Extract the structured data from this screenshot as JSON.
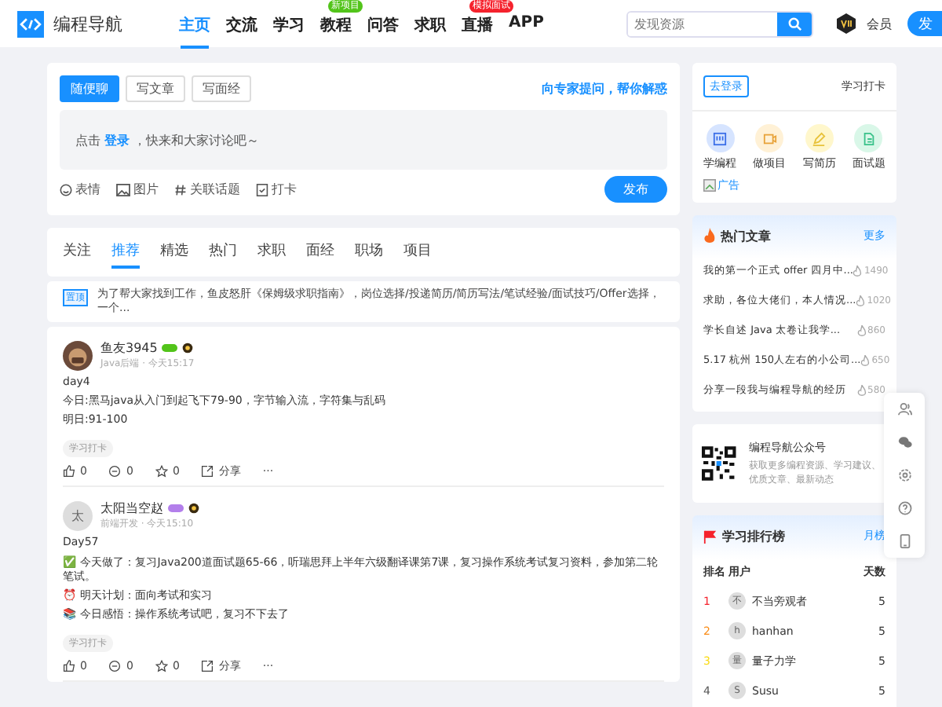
{
  "header": {
    "logo": "编程导航",
    "nav": [
      {
        "label": "主页",
        "selected": true
      },
      {
        "label": "交流",
        "selected": false
      },
      {
        "label": "学习",
        "selected": false
      },
      {
        "label": "教程",
        "selected": false,
        "badge": "新项目",
        "color": "#52c41a"
      },
      {
        "label": "问答",
        "selected": false
      },
      {
        "label": "求职",
        "selected": false
      },
      {
        "label": "直播",
        "selected": false,
        "badge": "模拟面试",
        "color": "#f5222d"
      },
      {
        "label": "APP",
        "selected": false
      }
    ],
    "search": {
      "placeholder": "发现资源"
    },
    "vip": "会员",
    "publish": "发"
  },
  "composer": {
    "tabs": [
      {
        "label": "随便聊",
        "selected": true
      },
      {
        "label": "写文章",
        "selected": false
      },
      {
        "label": "写面经",
        "selected": false
      }
    ],
    "ask_link": "向专家提问，帮你解惑",
    "prompt": "点击 **登录** ，快来和大家讨论吧～",
    "tools": [
      {
        "kind": "emoji",
        "label": "表情"
      },
      {
        "kind": "image",
        "label": "图片"
      },
      {
        "kind": "topic",
        "label": "关联话题"
      },
      {
        "kind": "checkin",
        "label": "打卡"
      }
    ],
    "submit": "发布"
  },
  "feed_tabs": [
    {
      "label": "关注",
      "selected": false
    },
    {
      "label": "推荐",
      "selected": true
    },
    {
      "label": "精选",
      "selected": false
    },
    {
      "label": "热门",
      "selected": false
    },
    {
      "label": "求职",
      "selected": false
    },
    {
      "label": "面经",
      "selected": false
    },
    {
      "label": "职场",
      "selected": false
    },
    {
      "label": "项目",
      "selected": false
    }
  ],
  "pinned": {
    "tag": "置顶",
    "text": "为了帮大家找到工作，鱼皮怒肝《保姆级求职指南》，岗位选择/投递简历/简历写法/笔试经验/面试技巧/Offer选择，一个..."
  },
  "posts": [
    {
      "author": "鱼友3945",
      "color": "#52c41a",
      "meta": "Java后端 · 今天15:17",
      "lines": [
        "day4",
        "今日:黑马java从入门到起飞下79-90，字节输入流，字符集与乱码",
        "明日:91-100"
      ],
      "tag": "学习打卡",
      "likes": "0",
      "comments": "0",
      "stars": "0",
      "share": "分享",
      "more": "···"
    },
    {
      "author": "太阳当空赵",
      "avatar": "太",
      "color": "#b37feb",
      "meta": "前端开发 · 今天15:10",
      "lines": [
        "Day57",
        "✅ 今天做了：复习Java200道面试题65-66，听瑞思拜上半年六级翻译课第7课，复习操作系统考试复习资料，参加第二轮笔试。",
        "⏰ 明天计划：面向考试和实习",
        "📚 今日感悟：操作系统考试吧，复习不下去了"
      ],
      "tag": "学习打卡",
      "likes": "0",
      "comments": "0",
      "stars": "0",
      "share": "分享",
      "more": "···"
    }
  ],
  "user_card": {
    "login": "去登录",
    "checkin": "学习打卡",
    "shortcuts": [
      {
        "kind": "code",
        "label": "学编程",
        "color": "#d6e4ff"
      },
      {
        "kind": "project",
        "label": "做项目",
        "color": "#fff1d6"
      },
      {
        "kind": "resume",
        "label": "写简历",
        "color": "#fff7cc"
      },
      {
        "kind": "questions",
        "label": "面试题",
        "color": "#d9f7e8"
      }
    ],
    "ad": "广告"
  },
  "hot": {
    "title": "热门文章",
    "more": "更多",
    "items": [
      {
        "title": "我的第一个正式 offer 四月中...",
        "views": "1490"
      },
      {
        "title": "求助，各位大佬们，本人情况...",
        "views": "1020"
      },
      {
        "title": "学长自述 Java 太卷让我学...",
        "views": "860"
      },
      {
        "title": "5.17 杭州 150人左右的小公司...",
        "views": "650"
      },
      {
        "title": "分享一段我与编程导航的经历",
        "views": "580"
      }
    ]
  },
  "wechat": {
    "title": "编程导航公众号",
    "desc": "获取更多编程资源、学习建议、优质文章、最新动态"
  },
  "ranking": {
    "title": "学习排行榜",
    "period": "月榜",
    "columns": [
      "排名",
      "用户",
      "天数"
    ],
    "rows": [
      {
        "rank": "1",
        "color": "#f5222d",
        "avatar": "不",
        "name": "不当旁观者",
        "days": "5"
      },
      {
        "rank": "2",
        "color": "#fa8c16",
        "avatar": "h",
        "name": "hanhan",
        "days": "5"
      },
      {
        "rank": "3",
        "color": "#fadb14",
        "avatar": "量",
        "name": "量子力学",
        "days": "5"
      },
      {
        "rank": "4",
        "color": "#555555",
        "avatar": "S",
        "name": "Susu",
        "days": "5"
      }
    ]
  },
  "float_tools": [
    {
      "kind": "users"
    },
    {
      "kind": "wechat"
    },
    {
      "kind": "settings"
    },
    {
      "kind": "help"
    },
    {
      "kind": "phone"
    }
  ]
}
